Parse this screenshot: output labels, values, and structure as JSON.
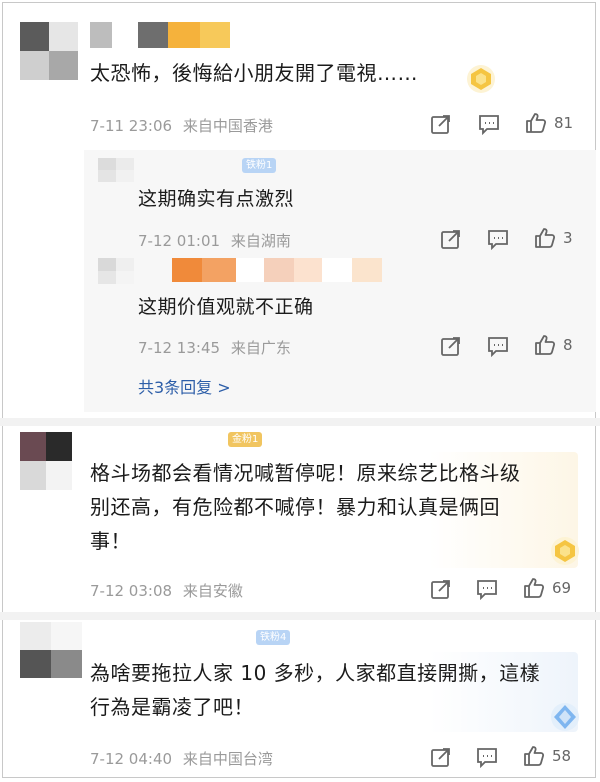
{
  "comments": [
    {
      "text": "太恐怖，後悔給小朋友開了電視……",
      "time": "7-11 23:06",
      "location": "来自中国香港",
      "likes": "81",
      "replies": [
        {
          "badge": "铁粉1",
          "text": "这期确实有点激烈",
          "time": "7-12 01:01",
          "location": "来自湖南",
          "likes": "3"
        },
        {
          "text": "这期价值观就不正确",
          "time": "7-12 13:45",
          "location": "来自广东",
          "likes": "8"
        }
      ],
      "more_replies": "共3条回复 >"
    },
    {
      "badge": "金粉1",
      "text_line1": "格斗场都会看情况喊暂停呢！原来综艺比格斗级",
      "text_line2": "别还高，有危险都不喊停！暴力和认真是俩回",
      "text_line3": "事！",
      "time": "7-12 03:08",
      "location": "来自安徽",
      "likes": "69"
    },
    {
      "badge": "铁粉4",
      "text_line1": "為啥要拖拉人家 10 多秒，人家都直接開撕，這樣",
      "text_line2": "行為是霸凌了吧！",
      "time": "7-12 04:40",
      "location": "来自中国台湾",
      "likes": "58"
    }
  ],
  "icons": {
    "share": "share-icon",
    "comment": "comment-icon",
    "like": "thumbs-up-icon",
    "medal": "fan-medal-icon"
  },
  "colors": {
    "link": "#2d5ea8",
    "meta": "#9a9a9a",
    "medal_gold": "#f5c542",
    "medal_blue": "#7fb6f0"
  }
}
